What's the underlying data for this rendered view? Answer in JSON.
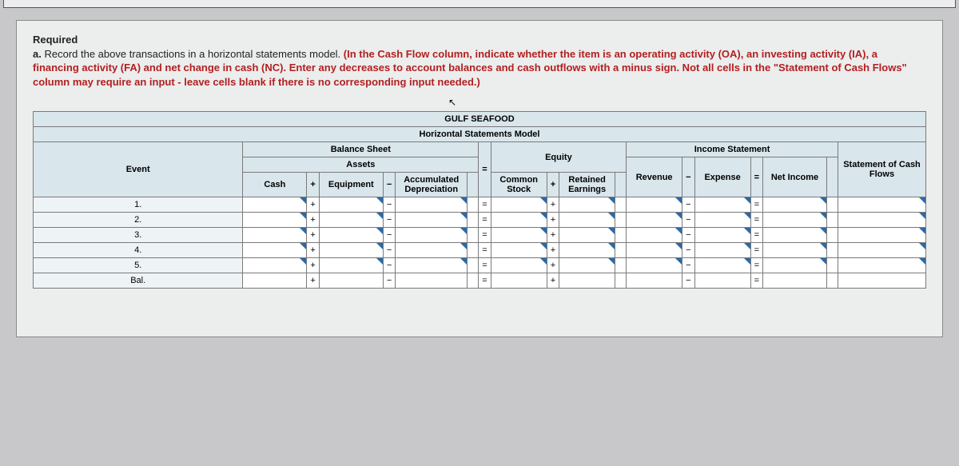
{
  "required": {
    "heading": "Required",
    "item_a_lead": "a. ",
    "item_a_black": "Record the above transactions in a horizontal statements model. ",
    "item_a_red": "(In the Cash Flow column, indicate whether the item is an operating activity (OA), an investing activity (IA), a financing activity (FA) and net change in cash (NC). Enter any decreases to account balances and cash outflows with a minus sign. Not all cells in the \"Statement of Cash Flows\" column may require an input - leave cells blank if there is no corresponding input needed.)"
  },
  "table": {
    "company": "GULF SEAFOOD",
    "subtitle": "Horizontal Statements Model",
    "sections": {
      "balance_sheet": "Balance Sheet",
      "income_statement": "Income Statement",
      "cash_flows": "Statement of Cash Flows"
    },
    "groups": {
      "event": "Event",
      "assets": "Assets",
      "equity": "Equity"
    },
    "cols": {
      "cash": "Cash",
      "equipment": "Equipment",
      "accum_dep": "Accumulated Depreciation",
      "common_stock": "Common Stock",
      "retained_earnings": "Retained Earnings",
      "revenue": "Revenue",
      "expense": "Expense",
      "net_income": "Net Income"
    },
    "ops": {
      "plus": "+",
      "minus": "−",
      "equals": "="
    },
    "rows": [
      "1.",
      "2.",
      "3.",
      "4.",
      "5.",
      "Bal."
    ]
  }
}
